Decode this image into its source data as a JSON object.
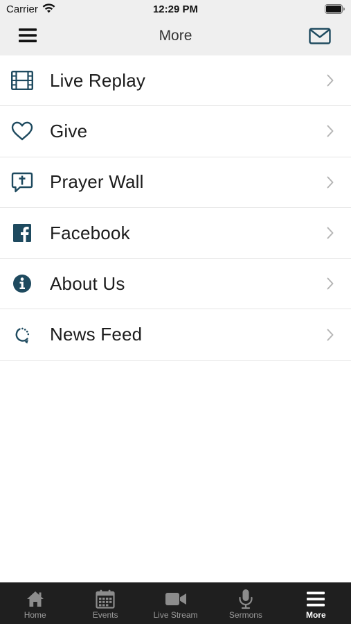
{
  "status_bar": {
    "carrier": "Carrier",
    "time": "12:29 PM"
  },
  "nav": {
    "title": "More",
    "left_icon": "hamburger-menu-icon",
    "right_icon": "mail-icon"
  },
  "colors": {
    "accent": "#1e4a5f",
    "nav_bg": "#efefef",
    "tab_bg": "#1f1f1f",
    "tab_inactive": "#9a9a9a",
    "tab_active": "#ffffff"
  },
  "menu_items": [
    {
      "label": "Live Replay",
      "icon": "film-icon"
    },
    {
      "label": "Give",
      "icon": "heart-icon"
    },
    {
      "label": "Prayer Wall",
      "icon": "prayer-bubble-icon"
    },
    {
      "label": "Facebook",
      "icon": "facebook-icon"
    },
    {
      "label": "About Us",
      "icon": "info-icon"
    },
    {
      "label": "News Feed",
      "icon": "refresh-feed-icon"
    }
  ],
  "tabs": [
    {
      "label": "Home",
      "icon": "home-icon",
      "active": false
    },
    {
      "label": "Events",
      "icon": "calendar-icon",
      "active": false
    },
    {
      "label": "Live Stream",
      "icon": "video-camera-icon",
      "active": false
    },
    {
      "label": "Sermons",
      "icon": "microphone-icon",
      "active": false
    },
    {
      "label": "More",
      "icon": "hamburger-menu-icon",
      "active": true
    }
  ]
}
